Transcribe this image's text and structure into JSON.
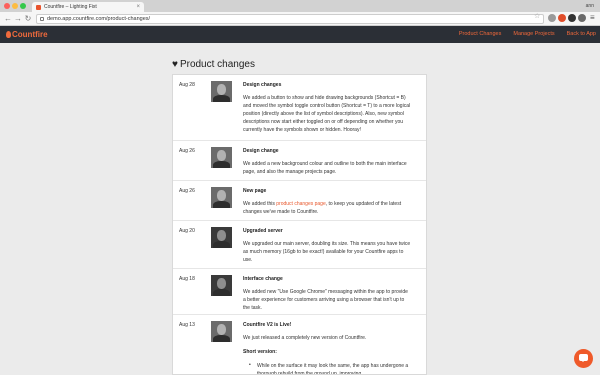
{
  "browser": {
    "tab_title": "Countfire – Lighting Fixt",
    "tab_close": "×",
    "user": "ann",
    "url": "demo.app.countfire.com/product-changes/",
    "back": "←",
    "forward": "→",
    "reload": "↻",
    "star": "☆",
    "menu": "≡"
  },
  "app": {
    "logo_text": "Countfire",
    "nav": [
      "Product Changes",
      "Manage Projects",
      "Back to App"
    ]
  },
  "page": {
    "heart": "♥",
    "title": "Product changes"
  },
  "entries": [
    {
      "date": "Aug 28",
      "title": "Design changes",
      "text": "We added a button to show and hide drawing backgrounds (Shortcut = B) and moved the symbol toggle control button (Shortcut = T) to a more logical position (directly above the list of symbol descriptions). Also, new symbol descriptions now start either toggled on or off depending on whether you currently have the symbols shown or hidden. Hooray!"
    },
    {
      "date": "Aug 26",
      "title": "Design change",
      "text": "We added a new background colour and outline to both the main interface page, and also the manage projects page."
    },
    {
      "date": "Aug 26",
      "title": "New page",
      "text_before": "We added this ",
      "link": "product changes page",
      "text_after": ", to keep you updated of the latest changes we've made to Countfire."
    },
    {
      "date": "Aug 20",
      "title": "Upgraded server",
      "text": "We upgraded our main server, doubling its size. This means you have twice as much memory (16gb to be exact!) available for your Countfire apps to use."
    },
    {
      "date": "Aug 18",
      "title": "Interface change",
      "text": "We added new \"Use Google Chrome\" messaging within the app to provide a better experience for customers arriving using a browser that isn't up to the task."
    },
    {
      "date": "Aug 13",
      "title": "Countfire V2 is Live!",
      "text": "We just released a completely new version of Countfire.",
      "subheading": "Short version:",
      "bullet": "•",
      "bullet_text": "While on the surface it may look the same, the app has undergone a thorough rebuild from the ground up, improving"
    }
  ]
}
